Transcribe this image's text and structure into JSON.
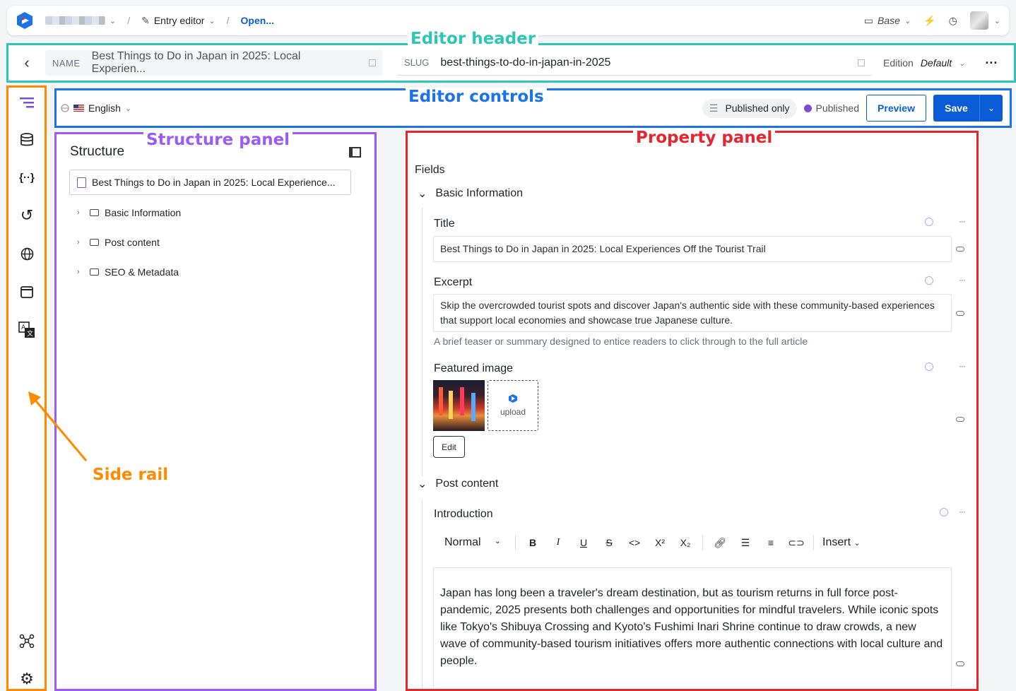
{
  "topbar": {
    "entry_editor": "Entry editor",
    "open_label": "Open...",
    "base_label": "Base"
  },
  "header": {
    "name_key": "NAME",
    "name_value": "Best Things to Do in Japan in 2025: Local Experien...",
    "slug_key": "SLUG",
    "slug_value": "best-things-to-do-in-japan-in-2025",
    "edition_key": "Edition",
    "edition_value": "Default"
  },
  "controls": {
    "language": "English",
    "published_only": "Published only",
    "status": "Published",
    "preview": "Preview",
    "save": "Save"
  },
  "structure": {
    "title": "Structure",
    "root": "Best Things to Do in Japan in 2025: Local Experience...",
    "items": [
      {
        "label": "Basic Information"
      },
      {
        "label": "Post content"
      },
      {
        "label": "SEO & Metadata"
      }
    ]
  },
  "property": {
    "fields_label": "Fields",
    "section1": "Basic Information",
    "title_label": "Title",
    "title_value": "Best Things to Do in Japan in 2025: Local Experiences Off the Tourist Trail",
    "excerpt_label": "Excerpt",
    "excerpt_value": "Skip the overcrowded tourist spots and discover Japan's authentic side with these community-based experiences that support local economies and showcase true Japanese culture.",
    "excerpt_help": "A brief teaser or summary designed to entice readers to click through to the full article",
    "image_label": "Featured image",
    "upload_label": "upload",
    "edit_label": "Edit",
    "section2": "Post content",
    "intro_label": "Introduction",
    "format_value": "Normal",
    "insert_label": "Insert",
    "intro_text": "Japan has long been a traveler's dream destination, but as tourism returns in full force post-pandemic, 2025 presents both challenges and opportunities for mindful travelers. While iconic spots like Tokyo's Shibuya Crossing and Kyoto's Fushimi Inari Shrine continue to draw crowds, a new wave of community-based tourism initiatives offers more authentic connections with local culture and people."
  },
  "annotations": {
    "editor_header": "Editor header",
    "editor_controls": "Editor controls",
    "structure_panel": "Structure panel",
    "property_panel": "Property panel",
    "side_rail": "Side rail"
  },
  "colors": {
    "header": "#2ec4b6",
    "controls": "#1a73e8",
    "structure": "#9b5cf6",
    "property": "#e5262e",
    "rail": "#ff8a00"
  }
}
